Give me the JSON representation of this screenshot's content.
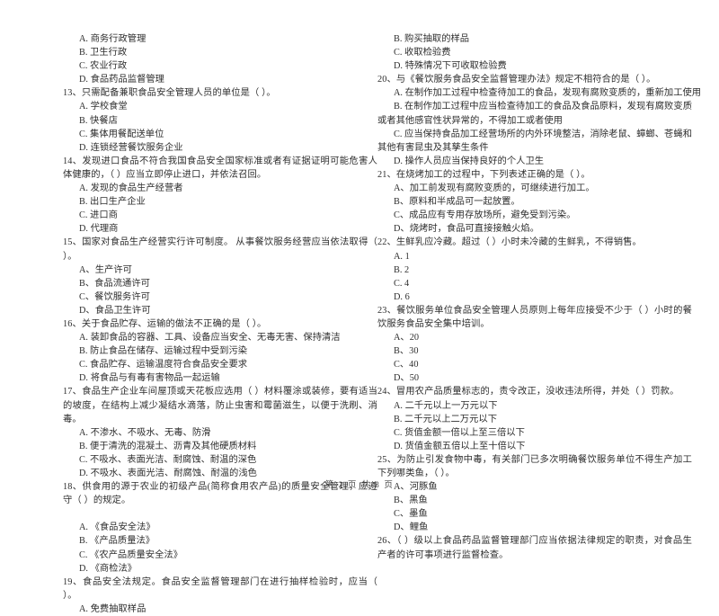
{
  "document": {
    "type": "exam-paper",
    "language": "zh-CN",
    "footer": "第 2 页 共 8 页"
  },
  "left_column": {
    "blocks": [
      {
        "kind": "option",
        "text": "A. 商务行政管理"
      },
      {
        "kind": "option",
        "text": "B. 卫生行政"
      },
      {
        "kind": "option",
        "text": "C. 农业行政"
      },
      {
        "kind": "option",
        "text": "D. 食品药品监督管理"
      },
      {
        "kind": "stem",
        "text": "13、只需配备兼职食品安全管理人员的单位是（      ）。"
      },
      {
        "kind": "option",
        "text": "A. 学校食堂"
      },
      {
        "kind": "option",
        "text": "B. 快餐店"
      },
      {
        "kind": "option",
        "text": "C. 集体用餐配送单位"
      },
      {
        "kind": "option",
        "text": "D. 连锁经营餐饮服务企业"
      },
      {
        "kind": "stem",
        "text": "14、发现进口食品不符合我国食品安全国家标准或者有证据证明可能危害人体健康的，（      ）应当立即停止进口，并依法召回。"
      },
      {
        "kind": "option",
        "text": "A. 发现的食品生产经营者"
      },
      {
        "kind": "option",
        "text": "B. 出口生产企业"
      },
      {
        "kind": "option",
        "text": "C. 进口商"
      },
      {
        "kind": "option",
        "text": "D. 代理商"
      },
      {
        "kind": "stem",
        "text": "15、国家对食品生产经营实行许可制度。 从事餐饮服务经营应当依法取得（      ）。"
      },
      {
        "kind": "option",
        "text": "A、生产许可"
      },
      {
        "kind": "option",
        "text": "B、食品流通许可"
      },
      {
        "kind": "option",
        "text": "C、餐饮服务许可"
      },
      {
        "kind": "option",
        "text": "D、食品卫生许可"
      },
      {
        "kind": "stem",
        "text": "16、关于食品贮存、运输的做法不正确的是（      ）。"
      },
      {
        "kind": "option",
        "text": "A. 装卸食品的容器、工具、设备应当安全、无毒无害、保持清洁"
      },
      {
        "kind": "option",
        "text": "B. 防止食品在储存、运输过程中受到污染"
      },
      {
        "kind": "option",
        "text": "C. 食品贮存、运输温度符合食品安全要求"
      },
      {
        "kind": "option",
        "text": "D. 将食品与有毒有害物品一起运输"
      },
      {
        "kind": "stem",
        "text": "17、食品生产企业车间屋顶或天花板应选用（      ）材料覆涂或装修，要有适当的坡度，在结构上减少凝结水滴落，防止虫害和霉菌滋生，以便于洗刷、消毒。"
      },
      {
        "kind": "option",
        "text": "A. 不渗水、不吸水、无毒、防滑"
      },
      {
        "kind": "option",
        "text": "B. 便于清洗的混凝土、沥青及其他硬质材料"
      },
      {
        "kind": "option",
        "text": "C. 不吸水、表面光洁、耐腐蚀、耐温的深色"
      },
      {
        "kind": "option",
        "text": "D. 不吸水、表面光洁、耐腐蚀、耐温的浅色"
      },
      {
        "kind": "stem",
        "text": "18、供食用的源于农业的初级产品(简称食用农产品)的质量安全管理，应遵守（      ）的规定。"
      },
      {
        "kind": "spacer",
        "text": ""
      },
      {
        "kind": "option",
        "text": "A. 《食品安全法》"
      },
      {
        "kind": "option",
        "text": "B. 《产品质量法》"
      },
      {
        "kind": "option",
        "text": "C. 《农产品质量安全法》"
      },
      {
        "kind": "option",
        "text": "D. 《商检法》"
      },
      {
        "kind": "stem",
        "text": "19、食品安全法规定。食品安全监督管理部门在进行抽样检验时，应当（      ）。"
      },
      {
        "kind": "option",
        "text": "A. 免费抽取样品"
      }
    ]
  },
  "right_column": {
    "blocks": [
      {
        "kind": "option",
        "text": "B. 购买抽取的样品"
      },
      {
        "kind": "option",
        "text": "C. 收取检验费"
      },
      {
        "kind": "option",
        "text": "D. 特殊情况下可收取检验费"
      },
      {
        "kind": "stem",
        "text": "20、与《餐饮服务食品安全监督管理办法》规定不相符合的是（      ）。"
      },
      {
        "kind": "option",
        "text": "A. 在制作加工过程中检查待加工的食品，发现有腐败变质的，重新加工使用"
      },
      {
        "kind": "option-hang",
        "text": "B. 在制作加工过程中应当检查待加工的食品及食品原料，发现有腐败变质或者其他感官性状异常的，不得加工或者使用"
      },
      {
        "kind": "option-hang",
        "text": "C. 应当保持食品加工经营场所的内外环境整洁，消除老鼠、蟑螂、苍蝇和其他有害昆虫及其孳生条件"
      },
      {
        "kind": "option",
        "text": "D. 操作人员应当保持良好的个人卫生"
      },
      {
        "kind": "stem",
        "text": "21、在烧烤加工的过程中，下列表述正确的是（      ）。"
      },
      {
        "kind": "option",
        "text": "A、加工前发现有腐败变质的，可继续进行加工。"
      },
      {
        "kind": "option",
        "text": "B、原料和半成品可一起放置。"
      },
      {
        "kind": "option",
        "text": "C、成品应有专用存放场所，避免受到污染。"
      },
      {
        "kind": "option",
        "text": "D、烧烤时，食品可直接接触火焰。"
      },
      {
        "kind": "stem",
        "text": "22、生鲜乳应冷藏。超过（      ）小时未冷藏的生鲜乳，不得销售。"
      },
      {
        "kind": "option",
        "text": "A. 1"
      },
      {
        "kind": "option",
        "text": "B. 2"
      },
      {
        "kind": "option",
        "text": "C. 4"
      },
      {
        "kind": "option",
        "text": "D. 6"
      },
      {
        "kind": "stem",
        "text": "23、餐饮服务单位食品安全管理人员原则上每年应接受不少于（      ）小时的餐饮服务食品安全集中培训。"
      },
      {
        "kind": "option",
        "text": "A、20"
      },
      {
        "kind": "option",
        "text": "B、30"
      },
      {
        "kind": "option",
        "text": "C、40"
      },
      {
        "kind": "option",
        "text": "D、50"
      },
      {
        "kind": "stem",
        "text": "24、冒用农产品质量标志的，责令改正，没收违法所得，并处（      ）罚款。"
      },
      {
        "kind": "option",
        "text": "A. 二千元以上一万元以下"
      },
      {
        "kind": "option",
        "text": "B. 二千元以上二万元以下"
      },
      {
        "kind": "option",
        "text": "C. 货值金额一倍以上至三倍以下"
      },
      {
        "kind": "option",
        "text": "D. 货值金额五倍以上至十倍以下"
      },
      {
        "kind": "stem",
        "text": "25、为防止引发食物中毒，有关部门已多次明确餐饮服务单位不得生产加工下列哪类鱼，（      ）。"
      },
      {
        "kind": "option",
        "text": "A、河豚鱼"
      },
      {
        "kind": "option",
        "text": "B、黑鱼"
      },
      {
        "kind": "option",
        "text": "C、墨鱼"
      },
      {
        "kind": "option",
        "text": "D、鲤鱼"
      },
      {
        "kind": "stem",
        "text": "26、（      ）级以上食品药品监督管理部门应当依据法律规定的职责，对食品生产者的许可事项进行监督检查。"
      }
    ]
  }
}
